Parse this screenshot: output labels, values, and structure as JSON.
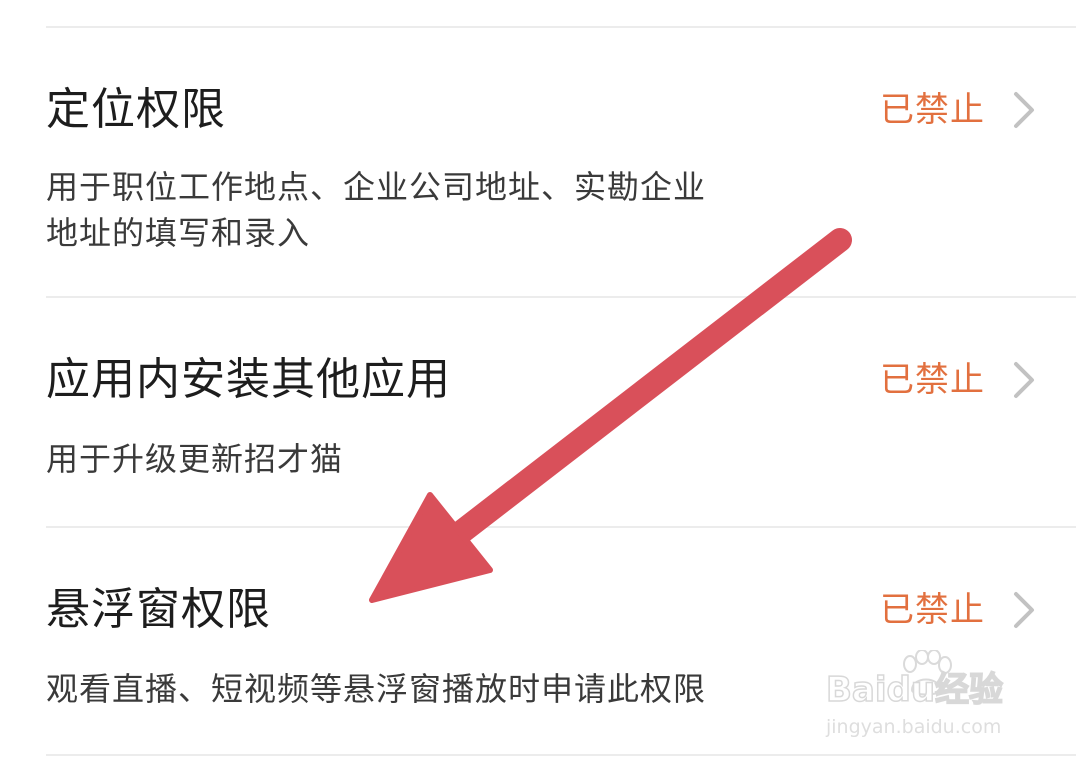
{
  "permissions": [
    {
      "title": "定位权限",
      "status": "已禁止",
      "description_lines": [
        "用于职位工作地点、企业公司地址、实勘企业",
        "地址的填写和录入"
      ]
    },
    {
      "title": "应用内安装其他应用",
      "status": "已禁止",
      "description_lines": [
        "用于升级更新招才猫"
      ]
    },
    {
      "title": "悬浮窗权限",
      "status": "已禁止",
      "description_lines": [
        "观看直播、短视频等悬浮窗播放时申请此权限"
      ]
    }
  ],
  "watermark": {
    "brand": "Baidu经验",
    "url": "jingyan.baidu.com"
  },
  "colors": {
    "status": "#e2703f",
    "arrow": "#d9505a",
    "divider": "#ececec",
    "chevron": "#c2c2c2"
  },
  "icons": {
    "chevron": "chevron-right-icon",
    "arrow": "annotation-arrow",
    "watermark": "baidu-paw-icon"
  }
}
